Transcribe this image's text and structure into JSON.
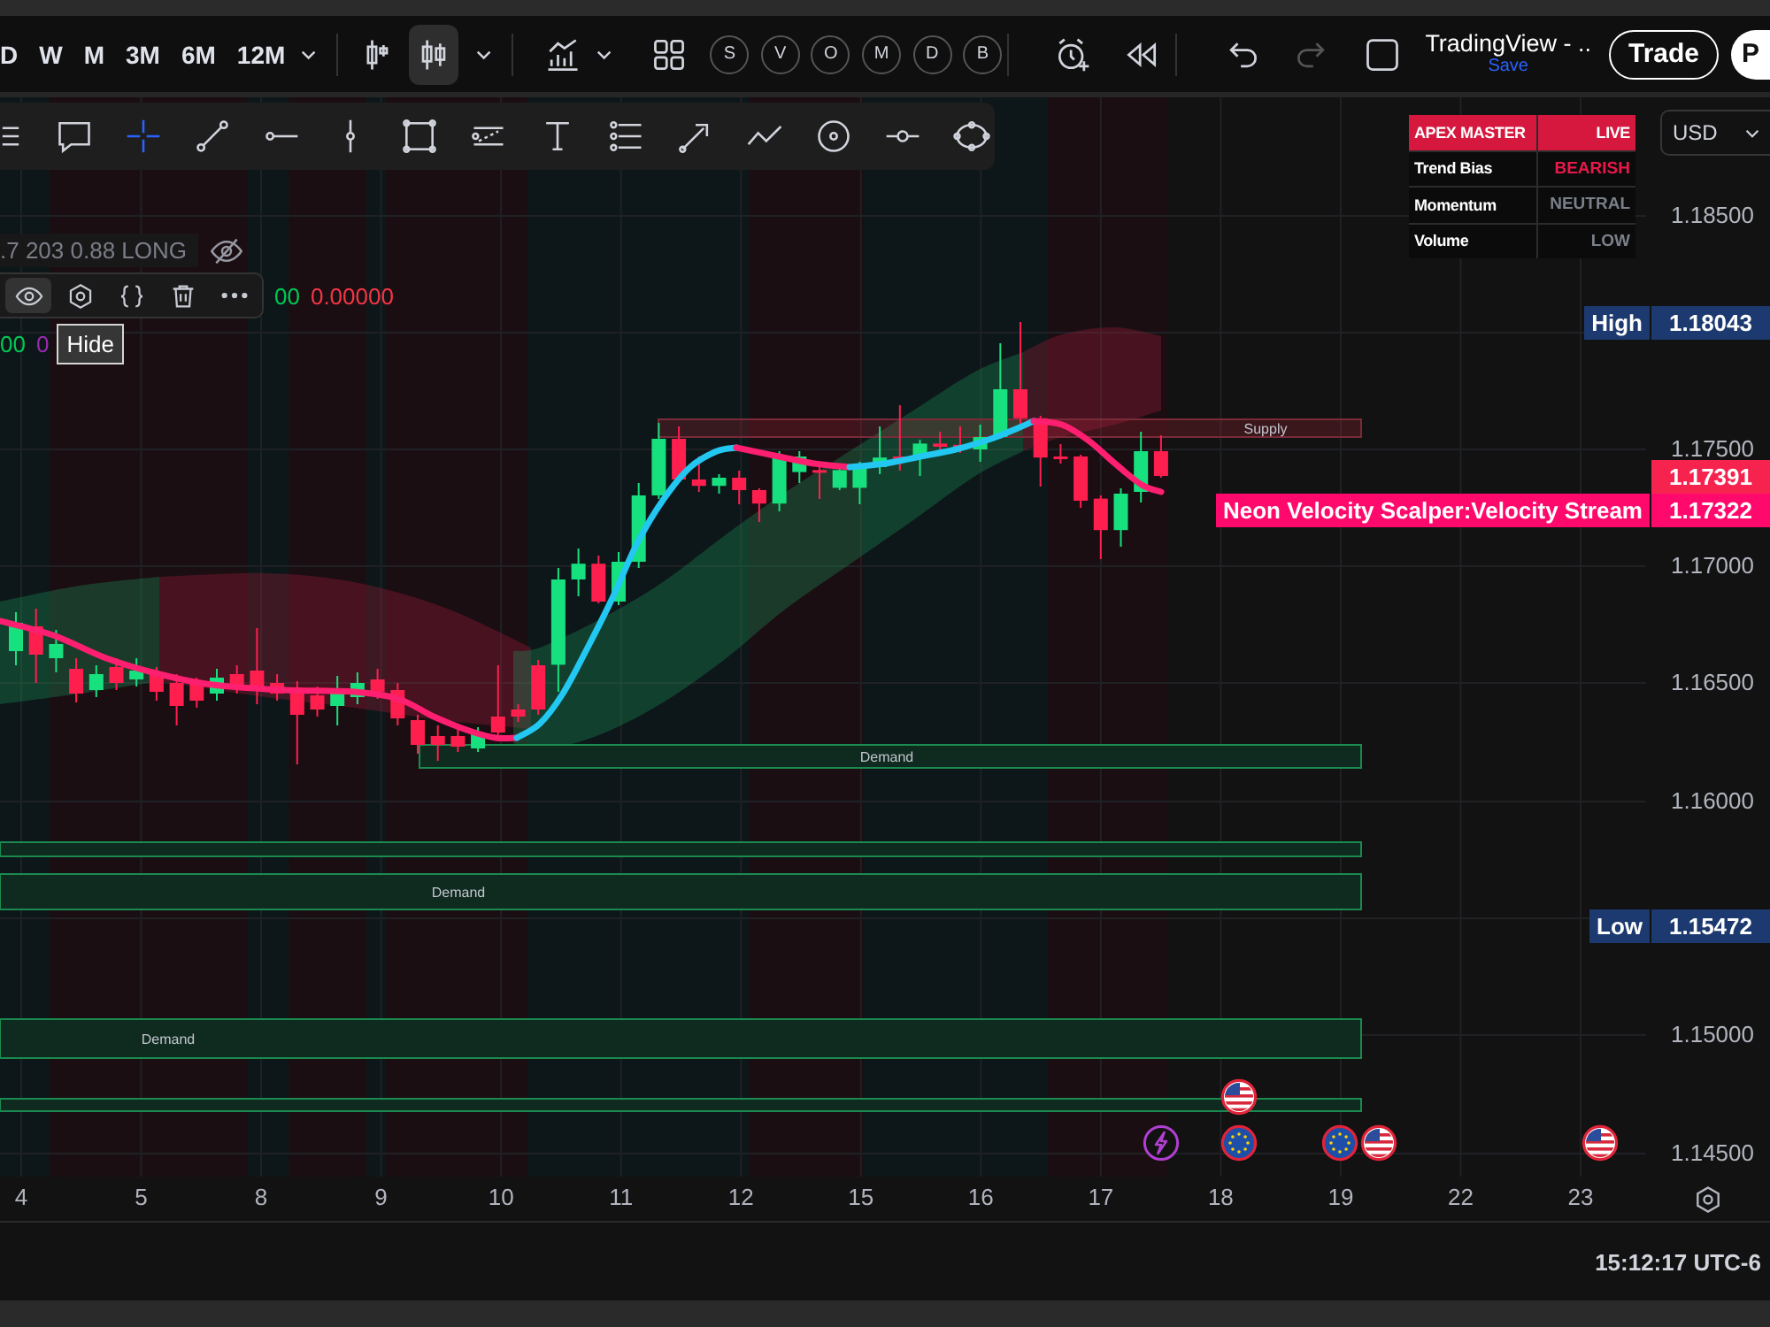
{
  "top_toolbar": {
    "intervals": [
      "D",
      "W",
      "M",
      "3M",
      "6M",
      "12M"
    ],
    "chart_styles": [
      {
        "kind": "bars",
        "selected": false
      },
      {
        "kind": "candles",
        "selected": true
      }
    ],
    "quick_buttons": [
      "S",
      "V",
      "O",
      "M",
      "D",
      "B"
    ],
    "history": [
      {
        "kind": "undo",
        "disabled": false
      },
      {
        "kind": "redo",
        "disabled": true
      }
    ],
    "layout_name": "TradingView - ..",
    "save_label": "Save",
    "trade_button": "Trade",
    "profile_button": "P"
  },
  "drawing_toolbar": {
    "tools": [
      {
        "kind": "lines",
        "selected": false
      },
      {
        "kind": "comment",
        "selected": false
      },
      {
        "kind": "crosshair",
        "selected": true
      },
      {
        "kind": "trend_line",
        "selected": false
      },
      {
        "kind": "horizontal_ray",
        "selected": false
      },
      {
        "kind": "vertical_line",
        "selected": false
      },
      {
        "kind": "rectangle",
        "selected": false
      },
      {
        "kind": "channel",
        "selected": false
      },
      {
        "kind": "text",
        "selected": false
      },
      {
        "kind": "fib",
        "selected": false
      },
      {
        "kind": "arrow",
        "selected": false
      },
      {
        "kind": "path",
        "selected": false
      },
      {
        "kind": "circle",
        "selected": false
      },
      {
        "kind": "ray",
        "selected": false
      },
      {
        "kind": "ellipse",
        "selected": false
      }
    ]
  },
  "legend": {
    "summary": ".7 203 0.88 LONG",
    "actions": [
      {
        "kind": "eye",
        "hovered": true
      },
      {
        "kind": "settings",
        "hovered": false
      },
      {
        "kind": "source",
        "hovered": false
      },
      {
        "kind": "delete",
        "hovered": false
      },
      {
        "kind": "more",
        "hovered": false
      }
    ],
    "rows": [
      {
        "values": [
          {
            "text": "00",
            "color": "#00c853"
          },
          {
            "text": "0.00000",
            "color": "#f23645"
          }
        ]
      },
      {
        "values": [
          {
            "text": "00",
            "color": "#00c853"
          },
          {
            "text": "0",
            "color": "#9c27b0"
          }
        ]
      }
    ],
    "tooltip": "Hide"
  },
  "status_table": {
    "title": "APEX MASTER",
    "status": "LIVE",
    "rows": [
      {
        "label": "Trend Bias",
        "value": "BEARISH",
        "color": "#e8194a"
      },
      {
        "label": "Momentum",
        "value": "NEUTRAL",
        "color": "#7a7f8a"
      },
      {
        "label": "Volume",
        "value": "LOW",
        "color": "#7a7f8a"
      }
    ]
  },
  "chart": {
    "zones": [
      {
        "kind": "supply",
        "label": "Supply"
      },
      {
        "kind": "demand",
        "label": "Demand"
      },
      {
        "kind": "demand"
      },
      {
        "kind": "demand",
        "label": "Demand"
      },
      {
        "kind": "demand",
        "label": "Demand"
      },
      {
        "kind": "demand"
      }
    ],
    "events": [
      {
        "kind": "lightning"
      },
      {
        "kind": "us"
      },
      {
        "kind": "eu"
      },
      {
        "kind": "eu"
      },
      {
        "kind": "us"
      },
      {
        "kind": "us"
      }
    ]
  },
  "price_axis": {
    "currency": "USD",
    "ticks": [
      "1.18500",
      "1.17500",
      "1.17000",
      "1.16500",
      "1.16000",
      "1.15000",
      "1.14500"
    ],
    "markers": [
      {
        "kind": "high",
        "label": "High",
        "price": "1.18043"
      },
      {
        "kind": "last",
        "price": "1.17391"
      },
      {
        "kind": "indicator",
        "label": "Neon Velocity Scalper:Velocity Stream",
        "price": "1.17322"
      },
      {
        "kind": "low",
        "label": "Low",
        "price": "1.15472"
      }
    ]
  },
  "time_axis": {
    "labels": [
      "4",
      "5",
      "8",
      "9",
      "10",
      "11",
      "12",
      "15",
      "16",
      "17",
      "18",
      "19",
      "22",
      "23"
    ]
  },
  "status_bar": {
    "clock": "15:12:17 UTC-6"
  }
}
